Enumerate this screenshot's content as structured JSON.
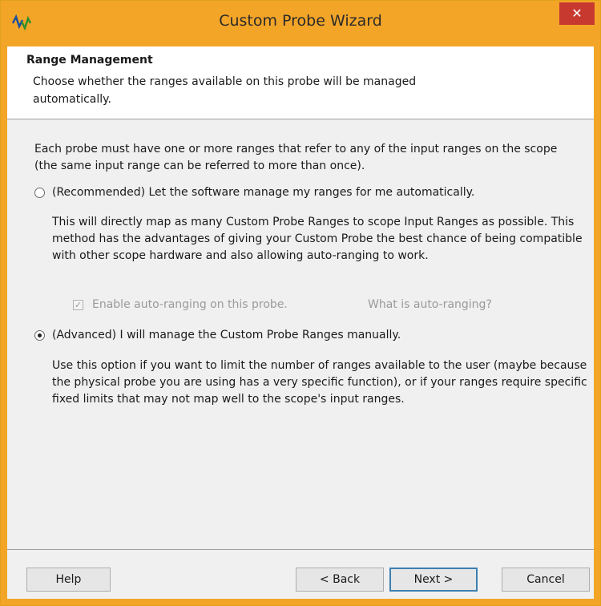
{
  "window": {
    "title": "Custom Probe Wizard",
    "close_glyph": "✕"
  },
  "header": {
    "title": "Range Management",
    "subtitle": "Choose whether the ranges available on this probe will be managed automatically."
  },
  "main": {
    "intro": "Each probe must have one or more ranges that refer to any of the input ranges on the scope (the same input range can be referred to more than once).",
    "option_recommended": {
      "label": "(Recommended) Let the software manage my ranges for me automatically.",
      "selected": false,
      "description": "This will directly map as many Custom Probe Ranges to scope Input Ranges as possible. This method has the advantages of giving your Custom Probe the best chance of being compatible with other scope hardware and also allowing auto-ranging to work."
    },
    "auto_ranging": {
      "label": "Enable auto-ranging on this probe.",
      "checked": true,
      "help_text": "What is auto-ranging?"
    },
    "option_advanced": {
      "label": "(Advanced) I will manage the Custom Probe Ranges manually.",
      "selected": true,
      "description": "Use this option if you want to limit the number of ranges available to the user (maybe because the physical probe you are using has a very specific function), or if your ranges require specific fixed limits that may not map well to the scope's input ranges."
    }
  },
  "footer": {
    "help": "Help",
    "back": "< Back",
    "next": "Next >",
    "cancel": "Cancel"
  },
  "colors": {
    "titlebar": "#f3a528",
    "close": "#c7392f",
    "default_button_border": "#3c7fb1"
  },
  "icons": {
    "app": "probe-waveform-icon",
    "close": "close-icon"
  }
}
